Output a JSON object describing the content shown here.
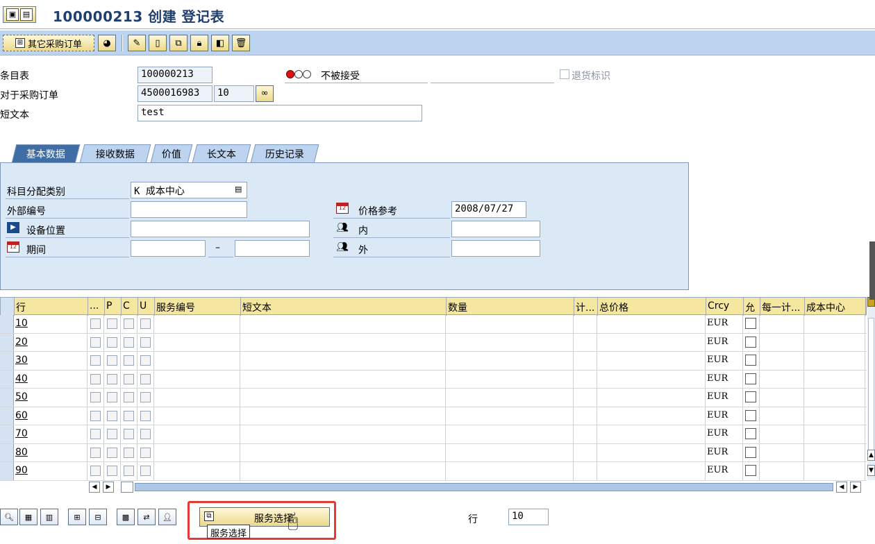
{
  "title": "100000213 创建 登记表",
  "toolbar": {
    "other_po_label": "其它采购订单"
  },
  "header": {
    "entry_sheet_label": "条目表",
    "entry_sheet_value": "100000213",
    "status_text": "不被接受",
    "return_label": "退货标识",
    "po_label": "对于采购订单",
    "po_value": "4500016983",
    "po_item": "10",
    "short_text_label": "短文本",
    "short_text_value": "test"
  },
  "tabs": [
    {
      "label": "基本数据"
    },
    {
      "label": "接收数据"
    },
    {
      "label": "价值"
    },
    {
      "label": "长文本"
    },
    {
      "label": "历史记录"
    }
  ],
  "basic": {
    "acct_cat_label": "科目分配类别",
    "acct_cat_value": "K 成本中心",
    "ext_no_label": "外部编号",
    "ext_no_value": "",
    "location_label": "设备位置",
    "location_value": "",
    "period_label": "期间",
    "period_sep": "–",
    "period_from": "",
    "period_to": "",
    "price_ref_label": "价格参考",
    "price_ref_value": "2008/07/27",
    "internal_label": "内",
    "internal_value": "",
    "external_label": "外",
    "external_value": ""
  },
  "grid": {
    "columns": [
      "行",
      "...",
      "P",
      "C",
      "U",
      "服务编号",
      "短文本",
      "数量",
      "计...",
      "总价格",
      "Crcy",
      "允",
      "每一计...",
      "成本中心"
    ],
    "rows": [
      {
        "line": "10",
        "crcy": "EUR"
      },
      {
        "line": "20",
        "crcy": "EUR"
      },
      {
        "line": "30",
        "crcy": "EUR"
      },
      {
        "line": "40",
        "crcy": "EUR"
      },
      {
        "line": "50",
        "crcy": "EUR"
      },
      {
        "line": "60",
        "crcy": "EUR"
      },
      {
        "line": "70",
        "crcy": "EUR"
      },
      {
        "line": "80",
        "crcy": "EUR"
      },
      {
        "line": "90",
        "crcy": "EUR"
      }
    ]
  },
  "bottom": {
    "service_select_label": "服务选择",
    "tooltip": "服务选择",
    "line_label": "行",
    "line_value": "10"
  },
  "colors": {
    "accent": "#3f6ea6",
    "toolbar": "#bcd4ef",
    "grid_header": "#f6e7a0",
    "highlight": "#e53935"
  }
}
